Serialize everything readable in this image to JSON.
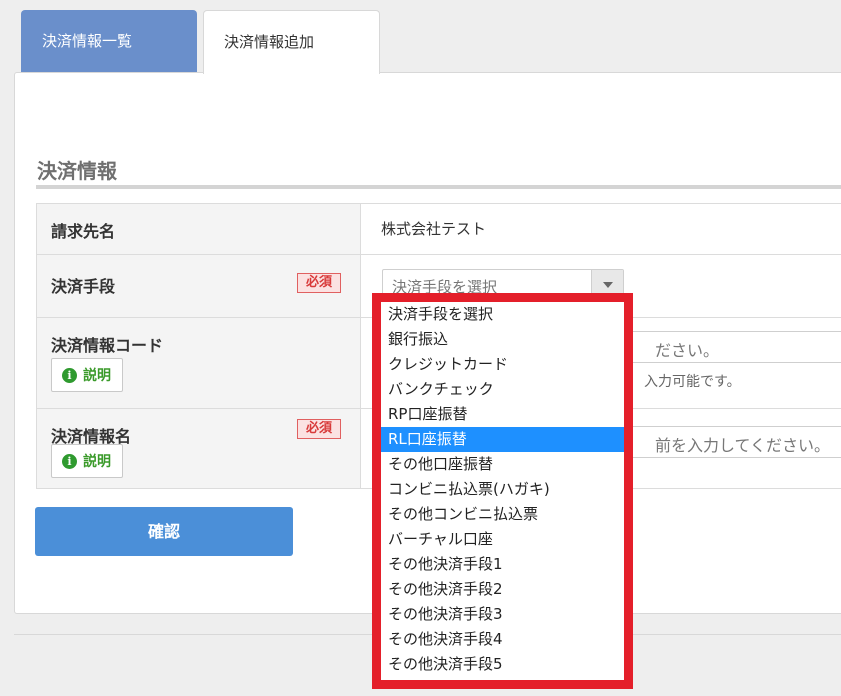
{
  "tabs": [
    {
      "label": "決済情報一覧"
    },
    {
      "label": "決済情報追加"
    }
  ],
  "section": {
    "title": "決済情報"
  },
  "form": {
    "billing_name": {
      "label": "請求先名",
      "value": "株式会社テスト"
    },
    "payment_method": {
      "label": "決済手段",
      "required": "必須",
      "placeholder": "決済手段を選択"
    },
    "payment_code": {
      "label": "決済情報コード",
      "help": "説明",
      "input_visible_text": "ださい。",
      "note_visible_text": "入力可能です。"
    },
    "payment_name": {
      "label": "決済情報名",
      "required": "必須",
      "help": "説明",
      "input_visible_text": "前を入力してください。"
    }
  },
  "submit_label": "確認",
  "dropdown": {
    "selected_index": 5,
    "options": [
      "決済手段を選択",
      "銀行振込",
      "クレジットカード",
      "バンクチェック",
      "RP口座振替",
      "RL口座振替",
      "その他口座振替",
      "コンビニ払込票(ハガキ)",
      "その他コンビニ払込票",
      "バーチャル口座",
      "その他決済手段1",
      "その他決済手段2",
      "その他決済手段3",
      "その他決済手段4",
      "その他決済手段5"
    ]
  },
  "colors": {
    "tab_active_bg": "#6a8fcb",
    "primary_button": "#4b8fd8",
    "highlight_border": "#e41f2a",
    "selected_option": "#1e90ff",
    "required_badge": "#d83a3a",
    "help_green": "#3a9a2a"
  },
  "icons": {
    "help": "info-icon",
    "select_arrow": "caret-down-icon"
  }
}
